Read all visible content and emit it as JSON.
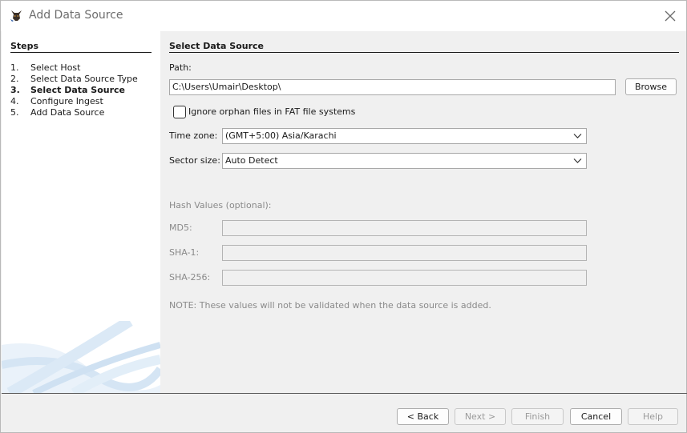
{
  "window": {
    "title": "Add Data Source",
    "app_icon": "autopsy-dog-icon",
    "close_icon": "close-icon"
  },
  "steps": {
    "title": "Steps",
    "items": [
      {
        "num": "1.",
        "label": "Select Host",
        "active": false
      },
      {
        "num": "2.",
        "label": "Select Data Source Type",
        "active": false
      },
      {
        "num": "3.",
        "label": "Select Data Source",
        "active": true
      },
      {
        "num": "4.",
        "label": "Configure Ingest",
        "active": false
      },
      {
        "num": "5.",
        "label": "Add Data Source",
        "active": false
      }
    ]
  },
  "main": {
    "title": "Select Data Source",
    "path_label": "Path:",
    "path_value": "C:\\Users\\Umair\\Desktop\\",
    "browse_label": "Browse",
    "orphan_checkbox_label": "Ignore orphan files in FAT file systems",
    "orphan_checked": false,
    "timezone_label": "Time zone:",
    "timezone_value": "(GMT+5:00) Asia/Karachi",
    "sector_label": "Sector size:",
    "sector_value": "Auto Detect",
    "hash_header": "Hash Values (optional):",
    "md5_label": "MD5:",
    "md5_value": "",
    "sha1_label": "SHA-1:",
    "sha1_value": "",
    "sha256_label": "SHA-256:",
    "sha256_value": "",
    "note": "NOTE: These values will not be validated when the data source is added."
  },
  "footer": {
    "back_label": "< Back",
    "next_label": "Next >",
    "finish_label": "Finish",
    "cancel_label": "Cancel",
    "help_label": "Help"
  }
}
